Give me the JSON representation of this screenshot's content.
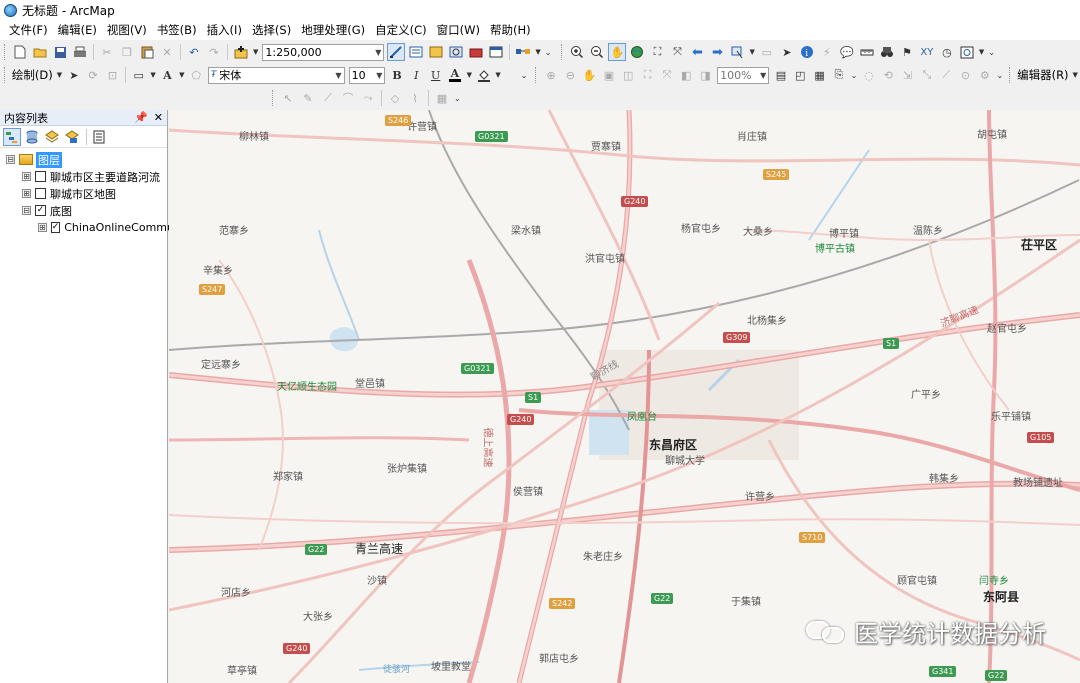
{
  "window": {
    "title": "无标题 - ArcMap"
  },
  "menu": [
    "文件(F)",
    "编辑(E)",
    "视图(V)",
    "书签(B)",
    "插入(I)",
    "选择(S)",
    "地理处理(G)",
    "自定义(C)",
    "窗口(W)",
    "帮助(H)"
  ],
  "toolbar": {
    "scale": "1:250,000",
    "draw_label": "绘制(D)",
    "font": "宋体",
    "font_size": "10",
    "bold": "B",
    "italic": "I",
    "underline": "U",
    "font_color_glyph": "A",
    "zoom_percent": "100%",
    "editor_label": "编辑器(R)"
  },
  "toc": {
    "title": "内容列表",
    "pin": "ᵖ",
    "close": "✕",
    "layers": [
      {
        "label": "图层",
        "level": 0,
        "expander": "⊟",
        "checkbox": null,
        "selected": true
      },
      {
        "label": "聊城市区主要道路河流",
        "level": 1,
        "expander": "⊞",
        "checkbox": false
      },
      {
        "label": "聊城市区地图",
        "level": 1,
        "expander": "⊞",
        "checkbox": false
      },
      {
        "label": "底图",
        "level": 1,
        "expander": "⊟",
        "checkbox": true
      },
      {
        "label": "ChinaOnlineCommu",
        "level": 2,
        "expander": "⊞",
        "checkbox": true
      }
    ]
  },
  "map": {
    "places": [
      "柳林镇",
      "许营镇",
      "贾寨镇",
      "肖庄镇",
      "胡屯镇",
      "范寨乡",
      "梁水镇",
      "杨官屯乡",
      "大桑乡",
      "博平镇",
      "温陈乡",
      "茌平区",
      "辛集乡",
      "洪官屯镇",
      "博平古镇",
      "北杨集乡",
      "赵官屯乡",
      "定远寨乡",
      "天亿顺生态园",
      "堂邑镇",
      "凤凰台",
      "东昌府区",
      "聊城大学",
      "广平乡",
      "乐平铺镇",
      "郑家镇",
      "张炉集镇",
      "侯营镇",
      "许营乡",
      "韩集乡",
      "教场铺遗址",
      "青兰高速",
      "朱老庄乡",
      "沙镇",
      "顾官屯镇",
      "闫寺乡",
      "东阿县",
      "河店乡",
      "大张乡",
      "于集镇",
      "郭店屯乡",
      "草亭镇",
      "徒骇河",
      "坡里教堂",
      "济聊高速",
      "德上高速",
      "聊济线"
    ],
    "shields": [
      "S246",
      "G0321",
      "S245",
      "G240",
      "S247",
      "G309",
      "S1",
      "G105",
      "G22",
      "S710",
      "S242",
      "G341"
    ],
    "watermark": "医学统计数据分析"
  }
}
